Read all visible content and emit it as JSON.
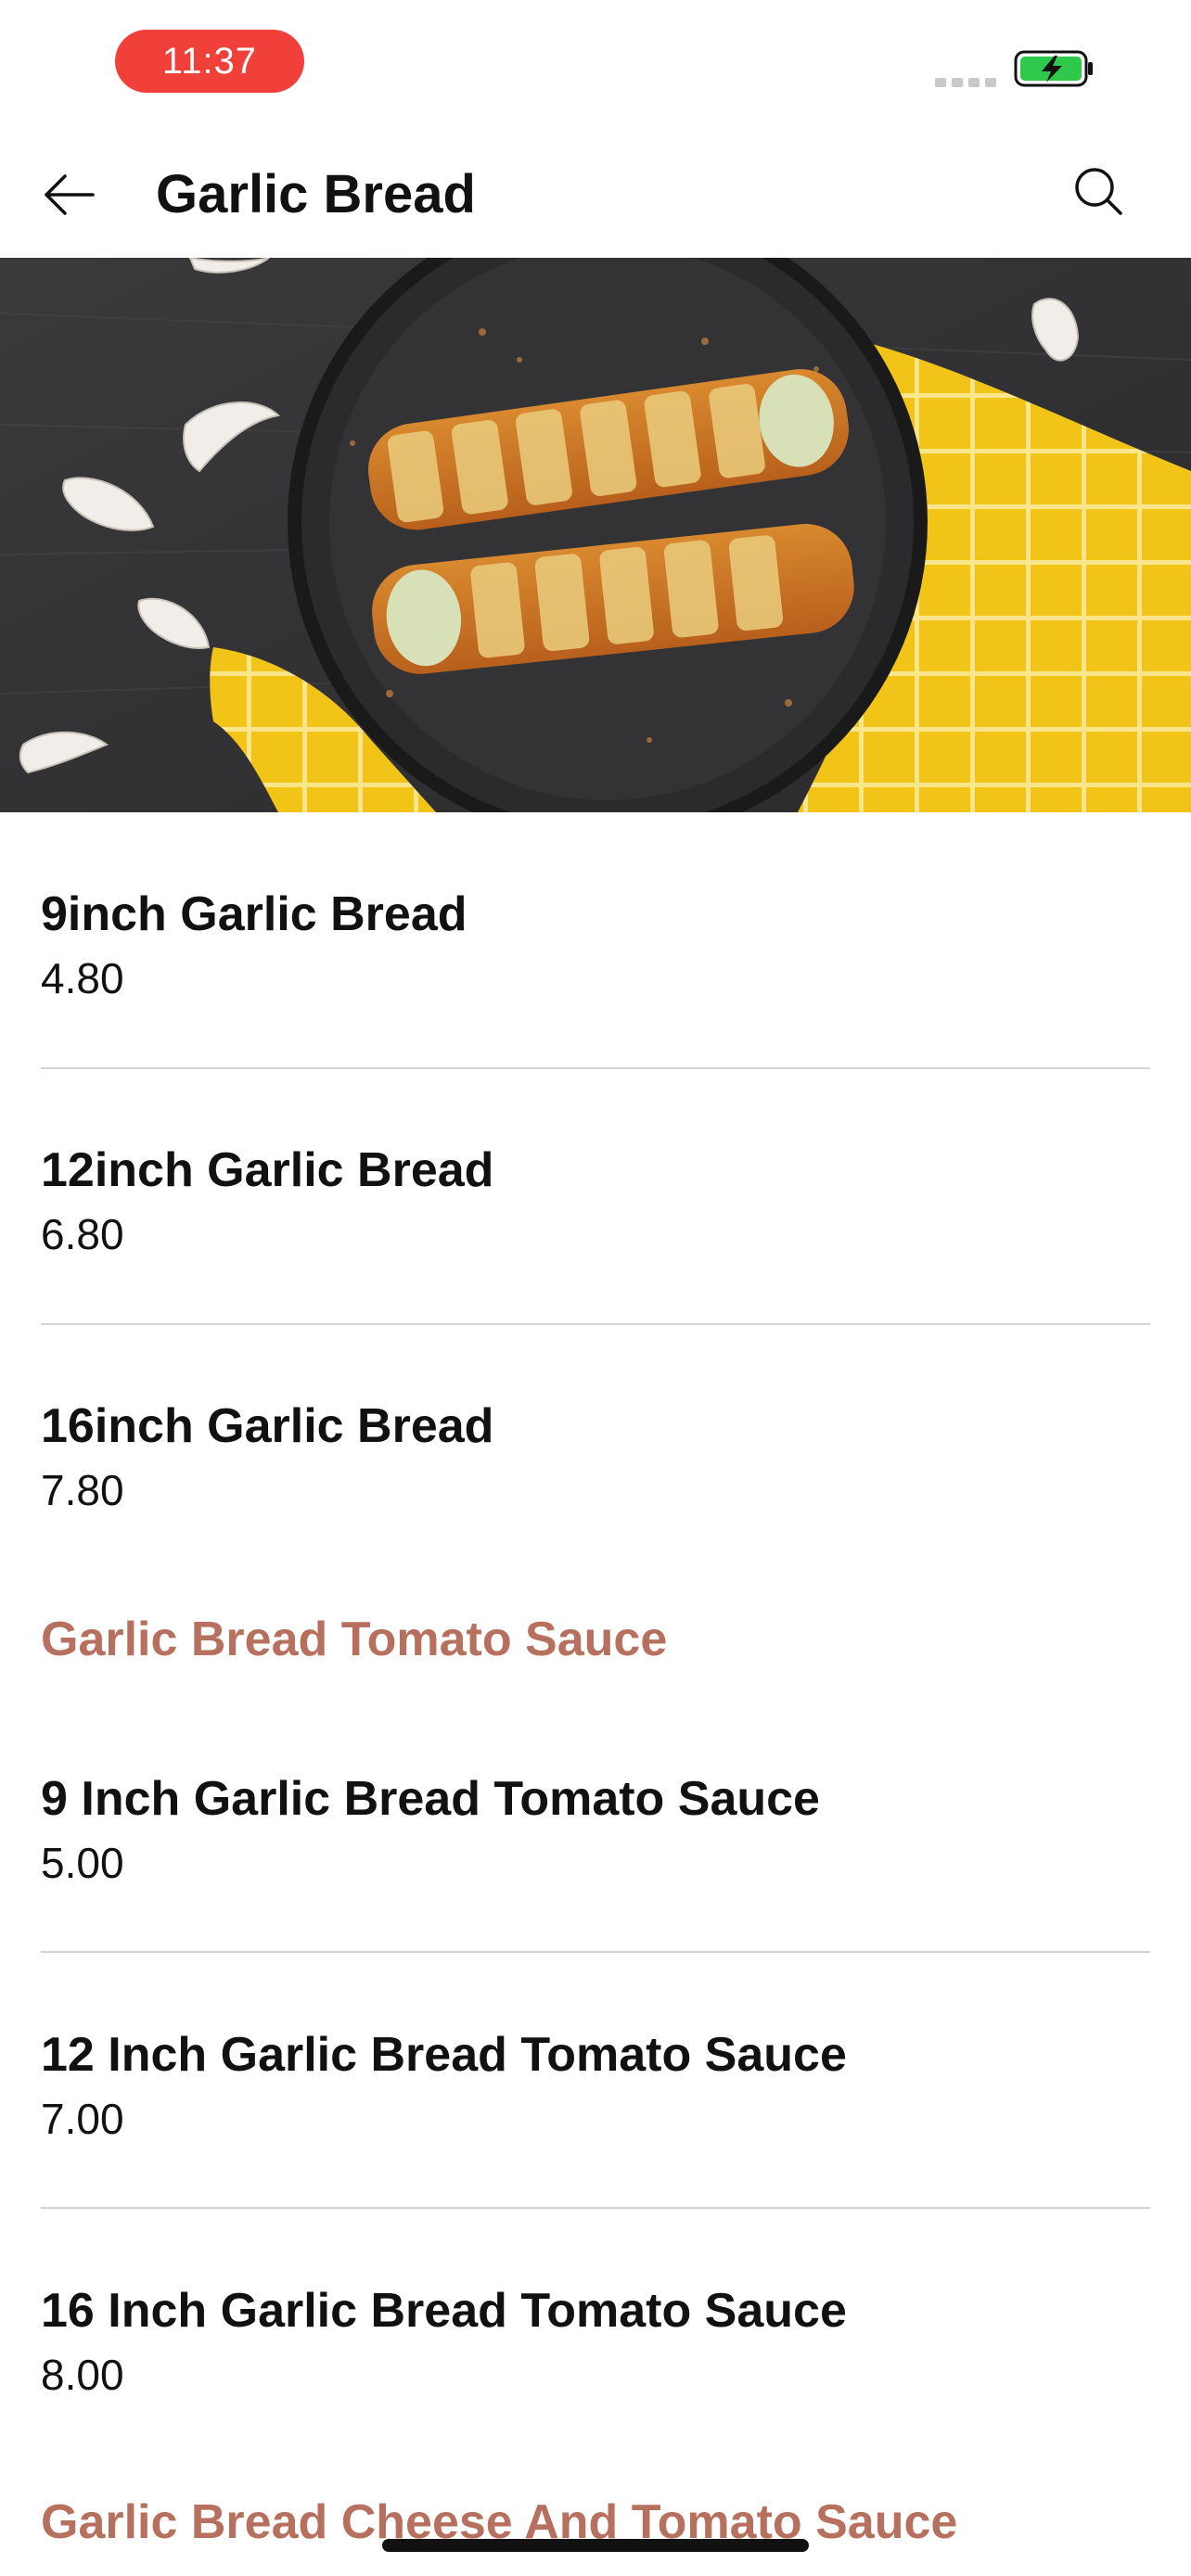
{
  "status_bar": {
    "time": "11:37",
    "time_pill_color": "#f1403a",
    "battery_color": "#2ec84a",
    "battery_state": "charging"
  },
  "header": {
    "title": "Garlic Bread",
    "back_icon": "arrow-left-icon",
    "search_icon": "search-icon"
  },
  "hero": {
    "image": "garlic-bread-photo"
  },
  "sections": [
    {
      "title": "",
      "items": [
        {
          "name": "9inch Garlic Bread",
          "price": "4.80"
        },
        {
          "name": "12inch Garlic Bread",
          "price": "6.80"
        },
        {
          "name": "16inch Garlic Bread",
          "price": "7.80"
        }
      ]
    },
    {
      "title": "Garlic Bread Tomato Sauce",
      "items": [
        {
          "name": "9 Inch Garlic Bread Tomato Sauce",
          "price": "5.00"
        },
        {
          "name": "12 Inch Garlic Bread Tomato Sauce",
          "price": "7.00"
        },
        {
          "name": "16 Inch Garlic Bread Tomato Sauce",
          "price": "8.00"
        }
      ]
    },
    {
      "title": "Garlic Bread Cheese And Tomato Sauce",
      "items": []
    }
  ],
  "colors": {
    "section_title": "#b8705e",
    "divider": "#d4d4d4",
    "text": "#111111"
  }
}
